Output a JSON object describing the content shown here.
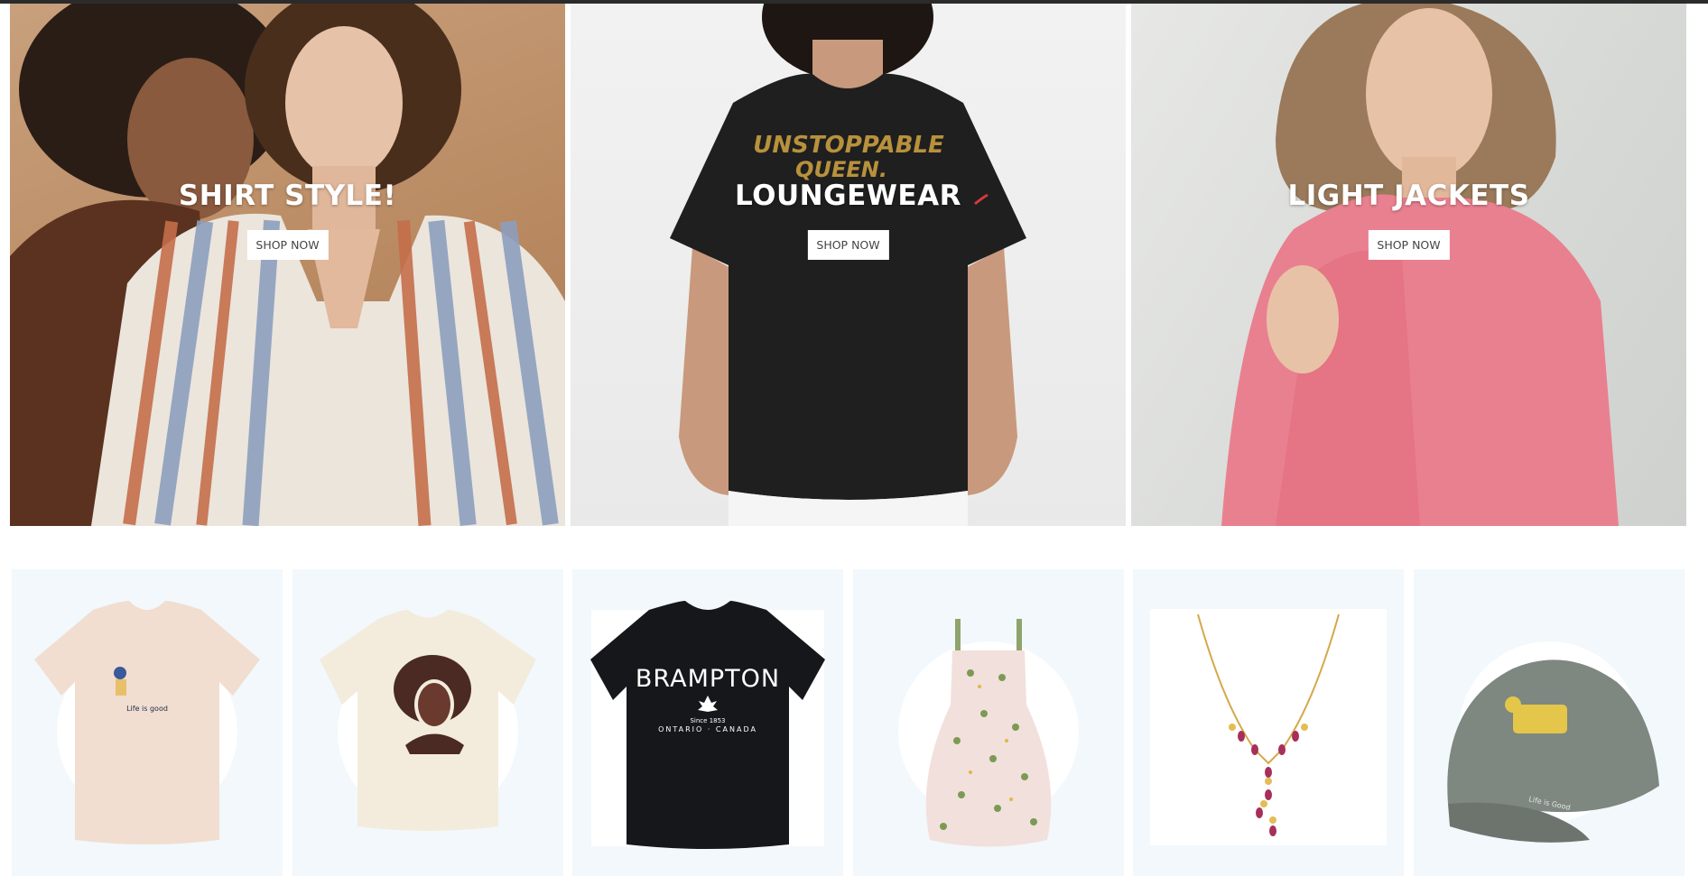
{
  "heroes": [
    {
      "title": "SHIRT STYLE!",
      "button": "SHOP NOW"
    },
    {
      "title": "LOUNGEWEAR",
      "button": "SHOP NOW"
    },
    {
      "title": "LIGHT JACKETS",
      "button": "SHOP NOW"
    }
  ],
  "tee_print_1": "UNSTOPPABLE",
  "tee_print_2": "QUEEN.",
  "products": {
    "tee_life": {
      "print": "Life is good"
    },
    "brampton": {
      "title": "BRAMPTON",
      "since": "Since 1853",
      "sub": "ONTARIO · CANADA"
    },
    "cap": {
      "print": "Life is Good"
    }
  },
  "colors": {
    "card_bg": "#f2f8fb",
    "top_bar": "#2b2b2b",
    "hero_text": "#ffffff"
  }
}
